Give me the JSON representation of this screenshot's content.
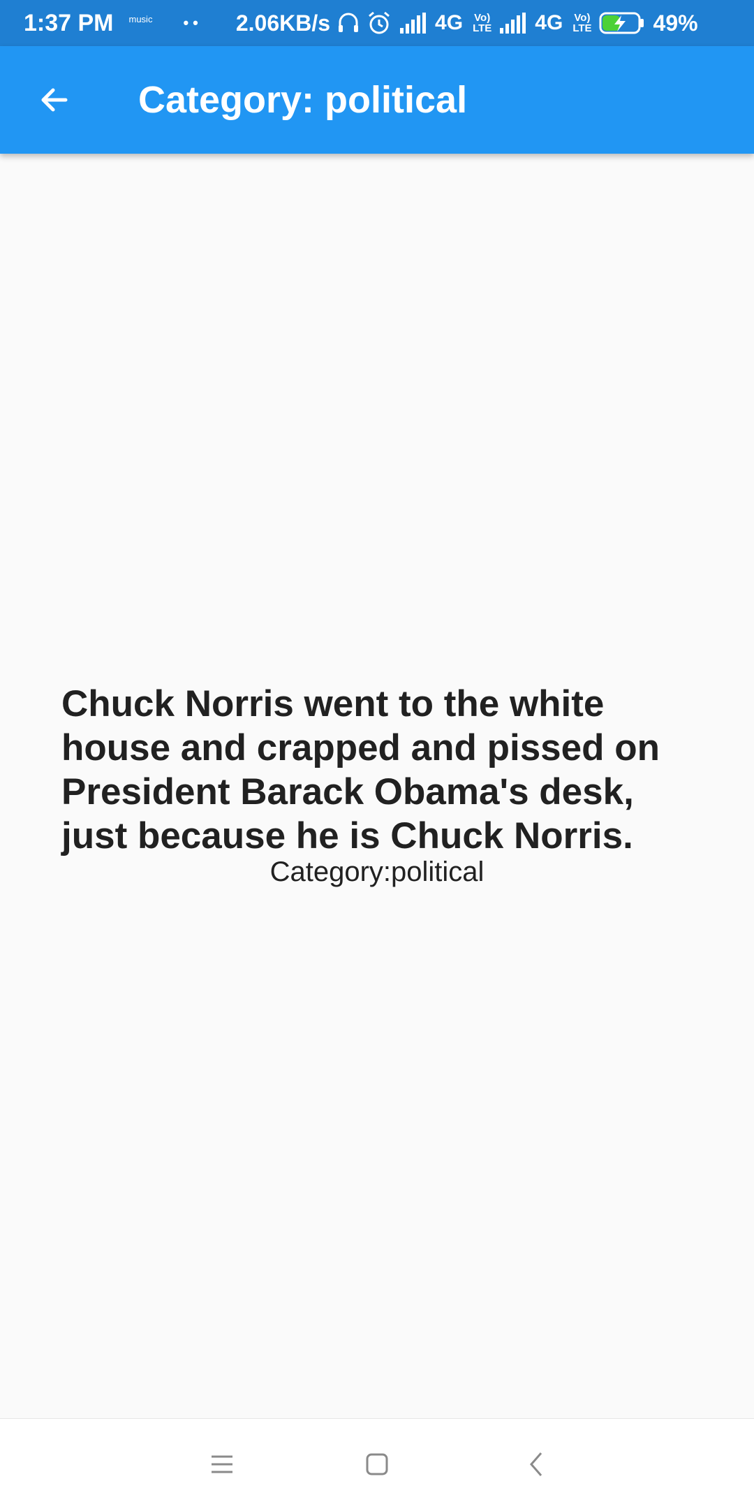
{
  "status_bar": {
    "time": "1:37 PM",
    "music_label": "music",
    "dots": "••",
    "speed": "2.06KB/s",
    "network1": "4G",
    "volte1_top": "Vo)",
    "volte1_bottom": "LTE",
    "network2": "4G",
    "volte2_top": "Vo)",
    "volte2_bottom": "LTE",
    "battery_percent": "49%",
    "battery_level": 0.49,
    "icons": [
      "headset-icon",
      "alarm-icon",
      "signal-icon",
      "signal-icon",
      "battery-charging-icon"
    ]
  },
  "app_bar": {
    "title": "Category: political",
    "back_icon": "arrow-back-icon",
    "color": "#2196f3"
  },
  "joke": {
    "text": "Chuck Norris went to the white house and crapped and pissed on President Barack Obama's desk, just because he is Chuck Norris.",
    "category": "Category:political"
  },
  "nav_bar": {
    "icons": [
      "menu-icon",
      "home-square-icon",
      "back-chevron-icon"
    ]
  }
}
